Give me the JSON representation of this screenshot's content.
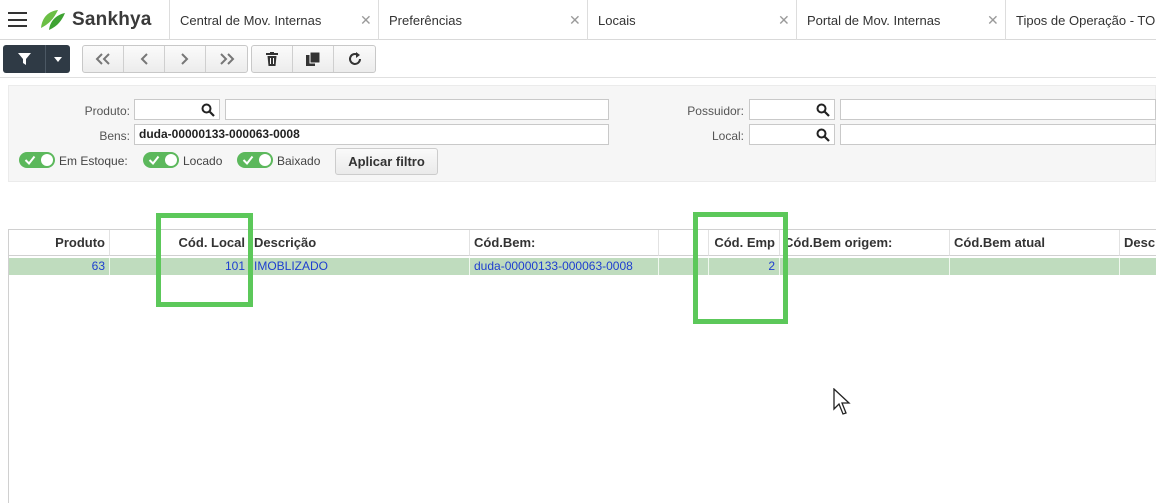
{
  "brand": {
    "name": "Sankhya"
  },
  "tabs": [
    {
      "label": "Central de Mov. Internas"
    },
    {
      "label": "Preferências"
    },
    {
      "label": "Locais"
    },
    {
      "label": "Portal de Mov. Internas"
    },
    {
      "label": "Tipos de Operação - TOP"
    }
  ],
  "filters": {
    "produto_label": "Produto:",
    "produto_code": "",
    "produto_desc": "",
    "bens_label": "Bens:",
    "bens_value": "duda-00000133-000063-0008",
    "possuidor_label": "Possuidor:",
    "possuidor_code": "",
    "possuidor_desc": "",
    "local_label": "Local:",
    "local_code": "",
    "local_desc": "",
    "toggles": [
      {
        "label": "Em Estoque:",
        "on": true
      },
      {
        "label": "Locado",
        "on": true
      },
      {
        "label": "Baixado",
        "on": true
      }
    ],
    "apply_label": "Aplicar filtro"
  },
  "grid": {
    "columns": [
      "Produto",
      "",
      "Cód. Local",
      "Descrição",
      "Cód.Bem:",
      "",
      "Cód. Emp",
      "Cód.Bem origem:",
      "Cód.Bem atual",
      "Descr"
    ],
    "rows": [
      [
        "63",
        "",
        "101",
        "IMOBLIZADO",
        "duda-00000133-000063-0008",
        "",
        "2",
        "",
        "",
        ""
      ]
    ]
  },
  "colors": {
    "accent": "#5cc85a",
    "row_selected": "#bfdcbe",
    "link_text": "#1e3ed0"
  }
}
